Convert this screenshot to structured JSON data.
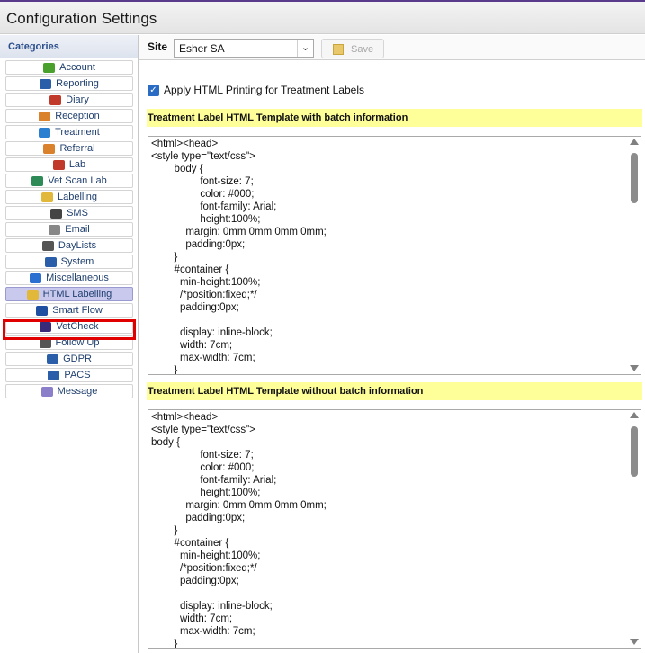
{
  "window": {
    "title": "Configuration Settings"
  },
  "sidebar": {
    "header": "Categories",
    "items": [
      {
        "label": "Account",
        "icon": "account-icon",
        "color": "#4aa02c"
      },
      {
        "label": "Reporting",
        "icon": "reporting-icon",
        "color": "#2b5ea8"
      },
      {
        "label": "Diary",
        "icon": "diary-icon",
        "color": "#c0392b"
      },
      {
        "label": "Reception",
        "icon": "reception-icon",
        "color": "#d9822b"
      },
      {
        "label": "Treatment",
        "icon": "treatment-icon",
        "color": "#2b7fd0"
      },
      {
        "label": "Referral",
        "icon": "referral-icon",
        "color": "#d9822b"
      },
      {
        "label": "Lab",
        "icon": "lab-icon",
        "color": "#c0392b"
      },
      {
        "label": "Vet Scan Lab",
        "icon": "vet-scan-lab-icon",
        "color": "#2e8b57"
      },
      {
        "label": "Labelling",
        "icon": "labelling-icon",
        "color": "#e1b83a"
      },
      {
        "label": "SMS",
        "icon": "sms-icon",
        "color": "#444444"
      },
      {
        "label": "Email",
        "icon": "email-icon",
        "color": "#888888"
      },
      {
        "label": "DayLists",
        "icon": "daylists-icon",
        "color": "#555555"
      },
      {
        "label": "System",
        "icon": "system-icon",
        "color": "#2b5ea8"
      },
      {
        "label": "Miscellaneous",
        "icon": "info-icon",
        "color": "#2b6fd0"
      },
      {
        "label": "HTML Labelling",
        "icon": "labelling-icon",
        "color": "#e1b83a",
        "selected": true
      },
      {
        "label": "Smart Flow",
        "icon": "smart-flow-icon",
        "color": "#1f4fa0"
      },
      {
        "label": "VetCheck",
        "icon": "vetcheck-icon",
        "color": "#3a2a7a"
      },
      {
        "label": "Follow Up",
        "icon": "follow-up-icon",
        "color": "#555555"
      },
      {
        "label": "GDPR",
        "icon": "gdpr-icon",
        "color": "#2b5ea8"
      },
      {
        "label": "PACS",
        "icon": "pacs-icon",
        "color": "#2b5ea8"
      },
      {
        "label": "Message",
        "icon": "message-icon",
        "color": "#8a7fc8"
      }
    ]
  },
  "toolbar": {
    "site_label": "Site",
    "site_value": "Esher SA",
    "save_label": "Save"
  },
  "options": {
    "apply_html_printing_label": "Apply HTML Printing for Treatment Labels",
    "apply_html_printing_checked": true
  },
  "sections": {
    "with_batch": {
      "header": "Treatment Label HTML Template with batch information",
      "content": "<html><head>\n<style type=\"text/css\">\n        body {\n                 font-size: 7;\n                 color: #000;\n                 font-family: Arial;\n                 height:100%;\n            margin: 0mm 0mm 0mm 0mm;\n            padding:0px;\n        }\n        #container {\n          min-height:100%;\n          /*position:fixed;*/\n          padding:0px;\n\n          display: inline-block;\n          width: 7cm;\n          max-width: 7cm;\n        }"
    },
    "without_batch": {
      "header": "Treatment Label HTML Template without batch information",
      "content": "<html><head>\n<style type=\"text/css\">\nbody {\n                 font-size: 7;\n                 color: #000;\n                 font-family: Arial;\n                 height:100%;\n            margin: 0mm 0mm 0mm 0mm;\n            padding:0px;\n        }\n        #container {\n          min-height:100%;\n          /*position:fixed;*/\n          padding:0px;\n\n          display: inline-block;\n          width: 7cm;\n          max-width: 7cm;\n        }"
    }
  }
}
